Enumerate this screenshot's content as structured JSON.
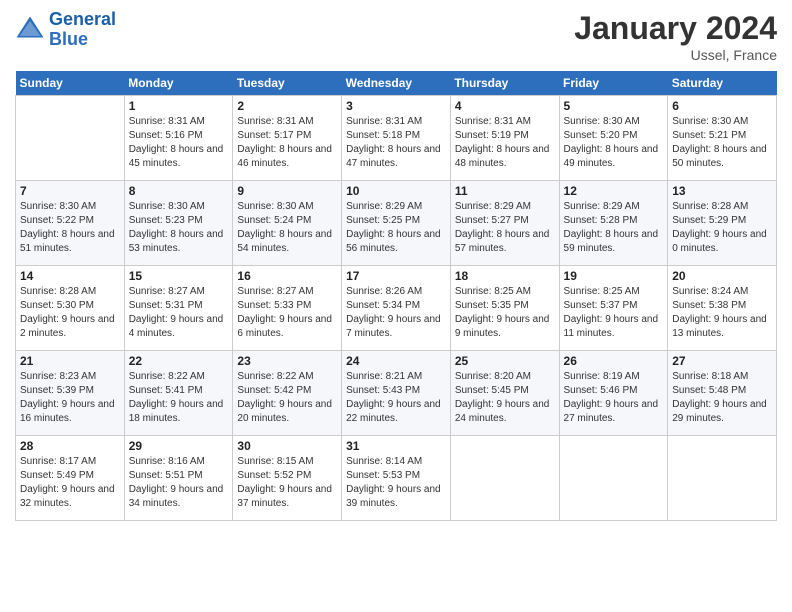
{
  "logo": {
    "line1": "General",
    "line2": "Blue"
  },
  "title": "January 2024",
  "location": "Ussel, France",
  "header_days": [
    "Sunday",
    "Monday",
    "Tuesday",
    "Wednesday",
    "Thursday",
    "Friday",
    "Saturday"
  ],
  "weeks": [
    [
      {
        "day": "",
        "sunrise": "",
        "sunset": "",
        "daylight": ""
      },
      {
        "day": "1",
        "sunrise": "Sunrise: 8:31 AM",
        "sunset": "Sunset: 5:16 PM",
        "daylight": "Daylight: 8 hours and 45 minutes."
      },
      {
        "day": "2",
        "sunrise": "Sunrise: 8:31 AM",
        "sunset": "Sunset: 5:17 PM",
        "daylight": "Daylight: 8 hours and 46 minutes."
      },
      {
        "day": "3",
        "sunrise": "Sunrise: 8:31 AM",
        "sunset": "Sunset: 5:18 PM",
        "daylight": "Daylight: 8 hours and 47 minutes."
      },
      {
        "day": "4",
        "sunrise": "Sunrise: 8:31 AM",
        "sunset": "Sunset: 5:19 PM",
        "daylight": "Daylight: 8 hours and 48 minutes."
      },
      {
        "day": "5",
        "sunrise": "Sunrise: 8:30 AM",
        "sunset": "Sunset: 5:20 PM",
        "daylight": "Daylight: 8 hours and 49 minutes."
      },
      {
        "day": "6",
        "sunrise": "Sunrise: 8:30 AM",
        "sunset": "Sunset: 5:21 PM",
        "daylight": "Daylight: 8 hours and 50 minutes."
      }
    ],
    [
      {
        "day": "7",
        "sunrise": "Sunrise: 8:30 AM",
        "sunset": "Sunset: 5:22 PM",
        "daylight": "Daylight: 8 hours and 51 minutes."
      },
      {
        "day": "8",
        "sunrise": "Sunrise: 8:30 AM",
        "sunset": "Sunset: 5:23 PM",
        "daylight": "Daylight: 8 hours and 53 minutes."
      },
      {
        "day": "9",
        "sunrise": "Sunrise: 8:30 AM",
        "sunset": "Sunset: 5:24 PM",
        "daylight": "Daylight: 8 hours and 54 minutes."
      },
      {
        "day": "10",
        "sunrise": "Sunrise: 8:29 AM",
        "sunset": "Sunset: 5:25 PM",
        "daylight": "Daylight: 8 hours and 56 minutes."
      },
      {
        "day": "11",
        "sunrise": "Sunrise: 8:29 AM",
        "sunset": "Sunset: 5:27 PM",
        "daylight": "Daylight: 8 hours and 57 minutes."
      },
      {
        "day": "12",
        "sunrise": "Sunrise: 8:29 AM",
        "sunset": "Sunset: 5:28 PM",
        "daylight": "Daylight: 8 hours and 59 minutes."
      },
      {
        "day": "13",
        "sunrise": "Sunrise: 8:28 AM",
        "sunset": "Sunset: 5:29 PM",
        "daylight": "Daylight: 9 hours and 0 minutes."
      }
    ],
    [
      {
        "day": "14",
        "sunrise": "Sunrise: 8:28 AM",
        "sunset": "Sunset: 5:30 PM",
        "daylight": "Daylight: 9 hours and 2 minutes."
      },
      {
        "day": "15",
        "sunrise": "Sunrise: 8:27 AM",
        "sunset": "Sunset: 5:31 PM",
        "daylight": "Daylight: 9 hours and 4 minutes."
      },
      {
        "day": "16",
        "sunrise": "Sunrise: 8:27 AM",
        "sunset": "Sunset: 5:33 PM",
        "daylight": "Daylight: 9 hours and 6 minutes."
      },
      {
        "day": "17",
        "sunrise": "Sunrise: 8:26 AM",
        "sunset": "Sunset: 5:34 PM",
        "daylight": "Daylight: 9 hours and 7 minutes."
      },
      {
        "day": "18",
        "sunrise": "Sunrise: 8:25 AM",
        "sunset": "Sunset: 5:35 PM",
        "daylight": "Daylight: 9 hours and 9 minutes."
      },
      {
        "day": "19",
        "sunrise": "Sunrise: 8:25 AM",
        "sunset": "Sunset: 5:37 PM",
        "daylight": "Daylight: 9 hours and 11 minutes."
      },
      {
        "day": "20",
        "sunrise": "Sunrise: 8:24 AM",
        "sunset": "Sunset: 5:38 PM",
        "daylight": "Daylight: 9 hours and 13 minutes."
      }
    ],
    [
      {
        "day": "21",
        "sunrise": "Sunrise: 8:23 AM",
        "sunset": "Sunset: 5:39 PM",
        "daylight": "Daylight: 9 hours and 16 minutes."
      },
      {
        "day": "22",
        "sunrise": "Sunrise: 8:22 AM",
        "sunset": "Sunset: 5:41 PM",
        "daylight": "Daylight: 9 hours and 18 minutes."
      },
      {
        "day": "23",
        "sunrise": "Sunrise: 8:22 AM",
        "sunset": "Sunset: 5:42 PM",
        "daylight": "Daylight: 9 hours and 20 minutes."
      },
      {
        "day": "24",
        "sunrise": "Sunrise: 8:21 AM",
        "sunset": "Sunset: 5:43 PM",
        "daylight": "Daylight: 9 hours and 22 minutes."
      },
      {
        "day": "25",
        "sunrise": "Sunrise: 8:20 AM",
        "sunset": "Sunset: 5:45 PM",
        "daylight": "Daylight: 9 hours and 24 minutes."
      },
      {
        "day": "26",
        "sunrise": "Sunrise: 8:19 AM",
        "sunset": "Sunset: 5:46 PM",
        "daylight": "Daylight: 9 hours and 27 minutes."
      },
      {
        "day": "27",
        "sunrise": "Sunrise: 8:18 AM",
        "sunset": "Sunset: 5:48 PM",
        "daylight": "Daylight: 9 hours and 29 minutes."
      }
    ],
    [
      {
        "day": "28",
        "sunrise": "Sunrise: 8:17 AM",
        "sunset": "Sunset: 5:49 PM",
        "daylight": "Daylight: 9 hours and 32 minutes."
      },
      {
        "day": "29",
        "sunrise": "Sunrise: 8:16 AM",
        "sunset": "Sunset: 5:51 PM",
        "daylight": "Daylight: 9 hours and 34 minutes."
      },
      {
        "day": "30",
        "sunrise": "Sunrise: 8:15 AM",
        "sunset": "Sunset: 5:52 PM",
        "daylight": "Daylight: 9 hours and 37 minutes."
      },
      {
        "day": "31",
        "sunrise": "Sunrise: 8:14 AM",
        "sunset": "Sunset: 5:53 PM",
        "daylight": "Daylight: 9 hours and 39 minutes."
      },
      {
        "day": "",
        "sunrise": "",
        "sunset": "",
        "daylight": ""
      },
      {
        "day": "",
        "sunrise": "",
        "sunset": "",
        "daylight": ""
      },
      {
        "day": "",
        "sunrise": "",
        "sunset": "",
        "daylight": ""
      }
    ]
  ]
}
